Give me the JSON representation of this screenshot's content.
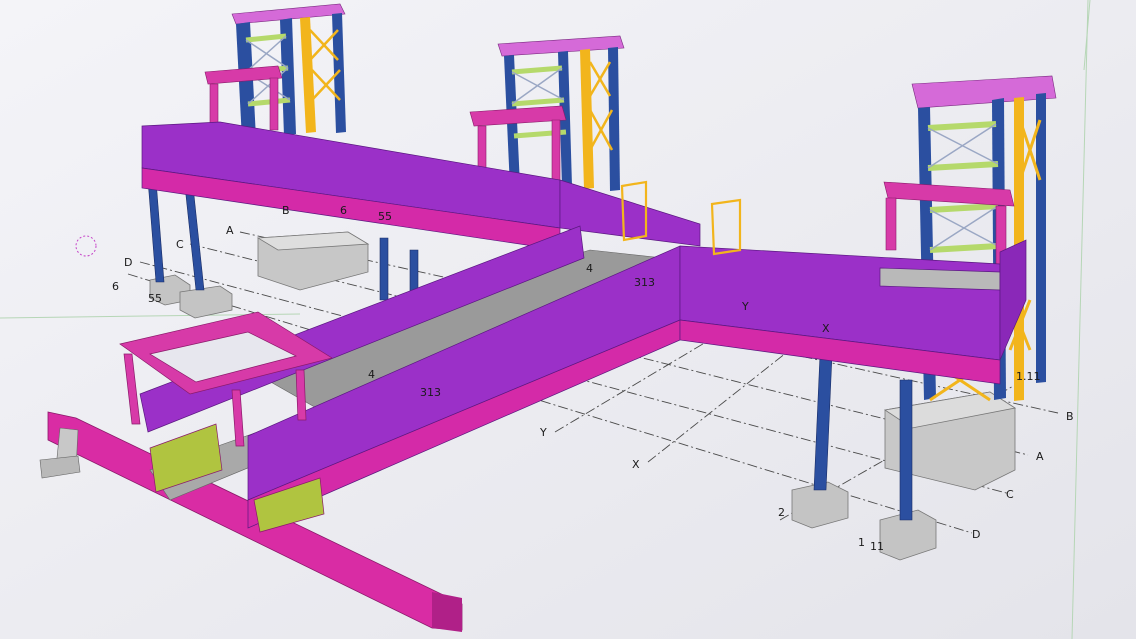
{
  "labels": {
    "B_top": "B",
    "A_top": "A",
    "C_top": "C",
    "D_top": "D",
    "six_left": "6",
    "six_mid": "6",
    "five_mid": "55",
    "five_left": "55",
    "four_a": "4",
    "four_b": "4",
    "three_a": "313",
    "three_b": "313",
    "Y_top": "Y",
    "X_top": "X",
    "Y_low": "Y",
    "X_low": "X",
    "B_right": "B",
    "A_right": "A",
    "C_right": "C",
    "D_right": "D",
    "two": "2",
    "one_low": "1",
    "eleven_low": "11",
    "eleven_top": "1.11",
    "x_top2": "X"
  },
  "colors": {
    "background": "#ececf1",
    "purple_wall": "#9b30c8",
    "magenta_beam": "#d42aa8",
    "blue_column": "#2b4fa0",
    "yellow_brace": "#f2b51c",
    "green_brace": "#b5d96b",
    "concrete": "#c9c9c9",
    "grid_line": "#555555"
  }
}
